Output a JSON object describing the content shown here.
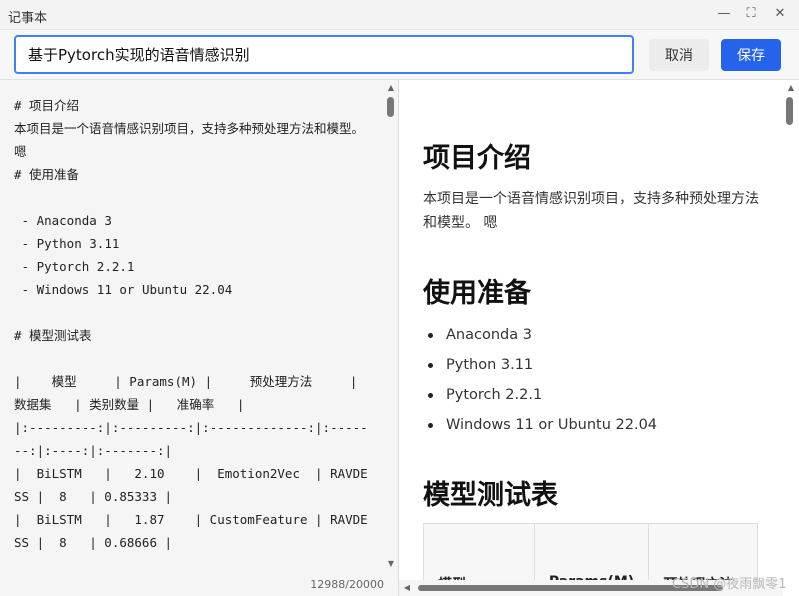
{
  "window": {
    "app_title": "记事本"
  },
  "toolbar": {
    "title_value": "基于Pytorch实现的语音情感识别",
    "cancel_label": "取消",
    "save_label": "保存"
  },
  "editor": {
    "content": "# 项目介绍\n本项目是一个语音情感识别项目，支持多种预处理方法和模型。\n嗯\n# 使用准备\n\n - Anaconda 3\n - Python 3.11\n - Pytorch 2.2.1\n - Windows 11 or Ubuntu 22.04\n\n# 模型测试表\n\n|    模型     | Params(M) |     预处理方法     |   数据集   | 类别数量 |   准确率   |\n|:---------:|:---------:|:-------------:|:-------:|:----:|:-------:|\n|  BiLSTM   |   2.10    |  Emotion2Vec  | RAVDESS |  8   | 0.85333 |\n|  BiLSTM   |   1.87    | CustomFeature | RAVDESS |  8   | 0.68666 |",
    "char_count": "12988/20000"
  },
  "preview": {
    "h1_intro": "项目介绍",
    "intro_text": "本项目是一个语音情感识别项目，支持多种预处理方法和模型。 嗯",
    "h1_prep": "使用准备",
    "prep_items": [
      "Anaconda 3",
      "Python 3.11",
      "Pytorch 2.2.1",
      "Windows 11 or Ubuntu 22.04"
    ],
    "h1_table": "模型测试表",
    "table_headers": [
      "模型",
      "Params(M)",
      "预处理方法"
    ]
  },
  "watermark": "CSDN @夜雨飘零1",
  "colors": {
    "accent": "#2563eb",
    "focus_border": "#3b82f6"
  }
}
